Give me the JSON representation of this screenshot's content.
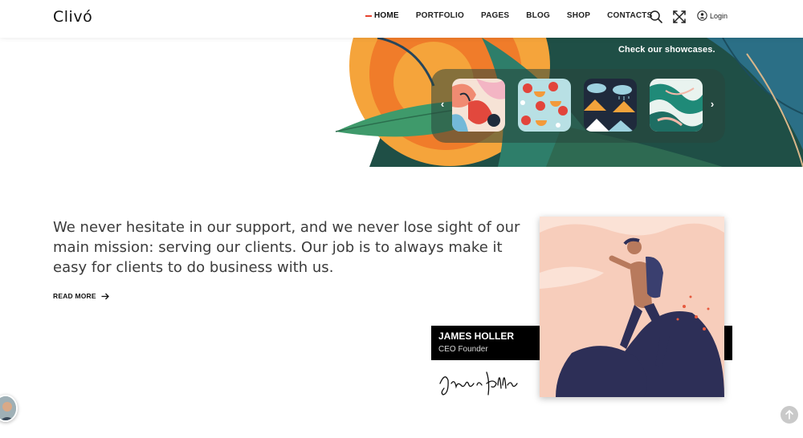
{
  "brand": {
    "logo": "Clivó"
  },
  "nav": {
    "items": [
      {
        "label": "HOME",
        "active": true
      },
      {
        "label": "PORTFOLIO"
      },
      {
        "label": "PAGES"
      },
      {
        "label": "BLOG"
      },
      {
        "label": "SHOP"
      },
      {
        "label": "CONTACTS"
      }
    ],
    "login_label": "Login",
    "icons": [
      "search-icon",
      "fullscreen-icon",
      "user-icon"
    ]
  },
  "hero": {
    "showcase_text": "Check our showcases.",
    "slider": {
      "thumbnails": [
        "abstract-shapes-pattern",
        "fruit-pattern",
        "mountain-cloud-pattern",
        "marble-pattern"
      ],
      "prev_icon": "chevron-left-icon",
      "next_icon": "chevron-right-icon"
    }
  },
  "about": {
    "mission": "We never hesitate in our support, and we never lose sight of our main mission: serving our clients. Our job is to always make it easy for clients to do business with us.",
    "read_more": "READ MORE",
    "person": {
      "name": "JAMES HOLLER",
      "role": "CEO Founder",
      "signature": "James Holler"
    }
  },
  "colors": {
    "accent": "#e6432f",
    "card_bg": "#000000",
    "portrait_bg": "#f7cdbb",
    "hero_orange": "#f39a3a",
    "hero_green": "#2f7a5f"
  }
}
